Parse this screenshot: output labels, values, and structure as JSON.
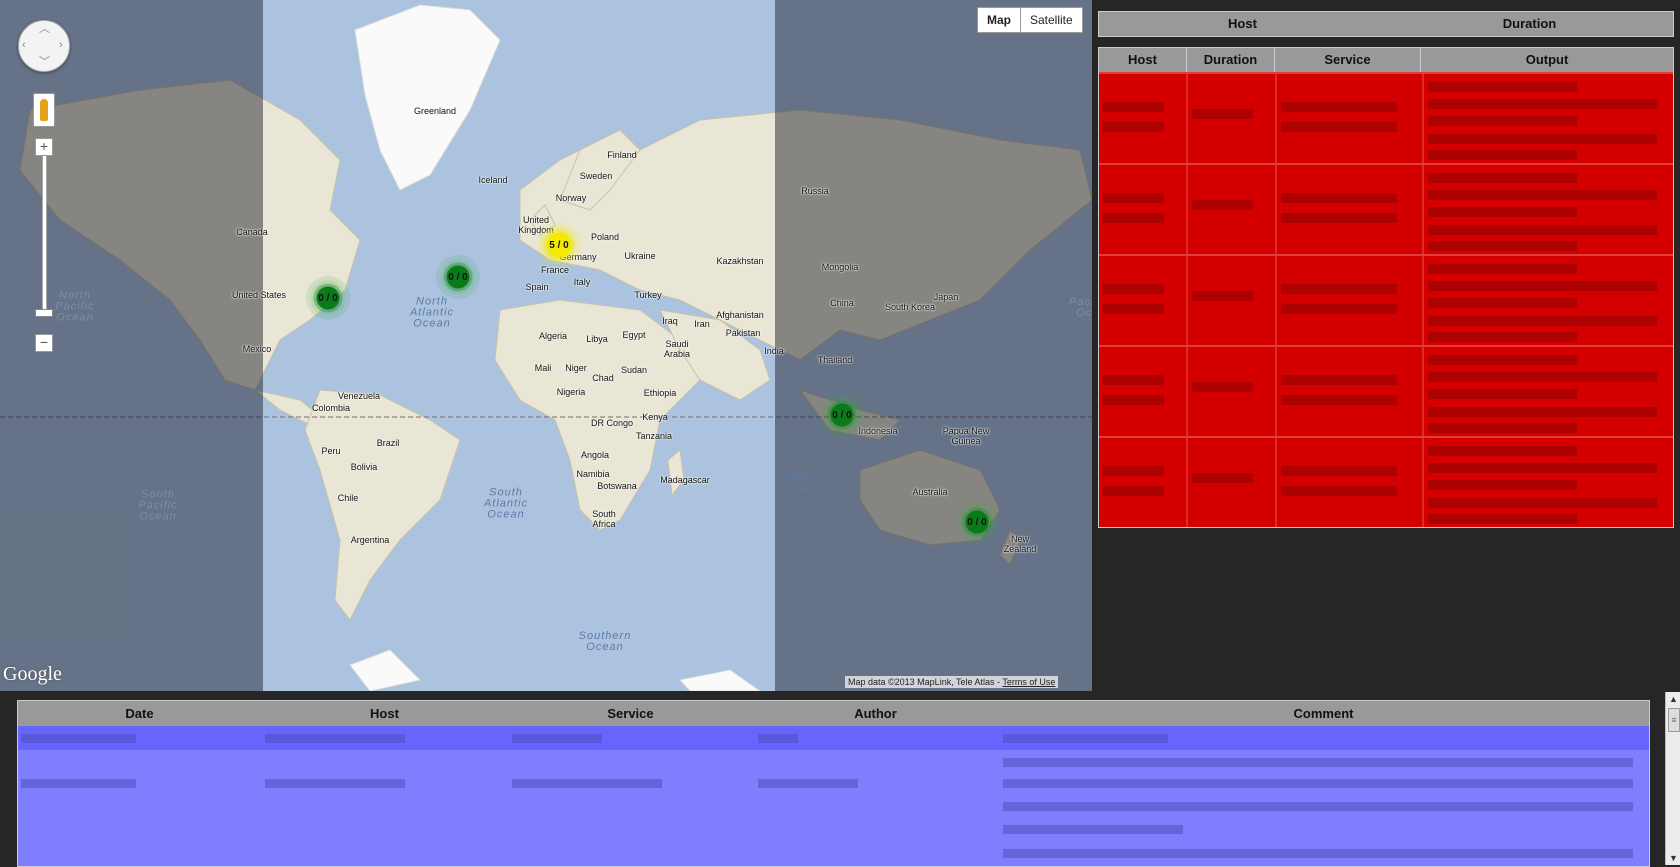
{
  "map": {
    "type_buttons": [
      "Map",
      "Satellite"
    ],
    "active_type": "Map",
    "attribution": "Map data ©2013 MapLink, Tele Atlas -",
    "terms_link": "Terms of Use",
    "logo": "Google",
    "icons": {
      "pan": "pan-control-icon",
      "pegman": "street-view-pegman-icon",
      "zoom_in": "zoom-in-icon",
      "zoom_out": "zoom-out-icon"
    },
    "zoom_in_label": "+",
    "zoom_out_label": "−",
    "zoom_level_fraction": 0.95,
    "places": [
      "Greenland",
      "Iceland",
      "Finland",
      "Sweden",
      "Norway",
      "United Kingdom",
      "Poland",
      "Germany",
      "France",
      "Ukraine",
      "Kazakhstan",
      "Spain",
      "Italy",
      "Turkey",
      "Russia",
      "Mongolia",
      "China",
      "South Korea",
      "Japan",
      "Canada",
      "United States",
      "Mexico",
      "Venezuela",
      "Colombia",
      "Brazil",
      "Peru",
      "Bolivia",
      "Chile",
      "Argentina",
      "Algeria",
      "Libya",
      "Egypt",
      "Iraq",
      "Iran",
      "Afghanistan",
      "Pakistan",
      "Saudi Arabia",
      "India",
      "Mali",
      "Niger",
      "Chad",
      "Sudan",
      "Nigeria",
      "Ethiopia",
      "Kenya",
      "DR Congo",
      "Tanzania",
      "Angola",
      "Namibia",
      "Botswana",
      "Madagascar",
      "South Africa",
      "Thailand",
      "Indonesia",
      "Papua New Guinea",
      "Australia",
      "New Zealand"
    ],
    "oceans": [
      "North Pacific Ocean",
      "North Atlantic Ocean",
      "South Pacific Ocean",
      "South Atlantic Ocean",
      "Indian Ocean",
      "Southern Ocean",
      "Pacific Oc"
    ],
    "clusters": [
      {
        "label": "0 / 0",
        "status": "green"
      },
      {
        "label": "0 / 0",
        "status": "green"
      },
      {
        "label": "5 / 0",
        "status": "yellow"
      },
      {
        "label": "0 / 0",
        "status": "green"
      },
      {
        "label": "0 / 0",
        "status": "green"
      }
    ],
    "colors": {
      "water": "#abc3df",
      "land": "#e9e6d6",
      "ok": "#0b7a19",
      "warn": "#f3ea00"
    }
  },
  "summary_table": {
    "headers": [
      "Host",
      "Duration"
    ]
  },
  "problems_table": {
    "headers": [
      "Host",
      "Duration",
      "Service",
      "Output"
    ],
    "row_count": 5,
    "row_color": "#d40000"
  },
  "comments_table": {
    "headers": [
      "Date",
      "Host",
      "Service",
      "Author",
      "Comment"
    ],
    "row_color": "#7e7eff"
  },
  "scrollbar": {
    "up": "▲",
    "down": "▼",
    "grip": "≡"
  }
}
